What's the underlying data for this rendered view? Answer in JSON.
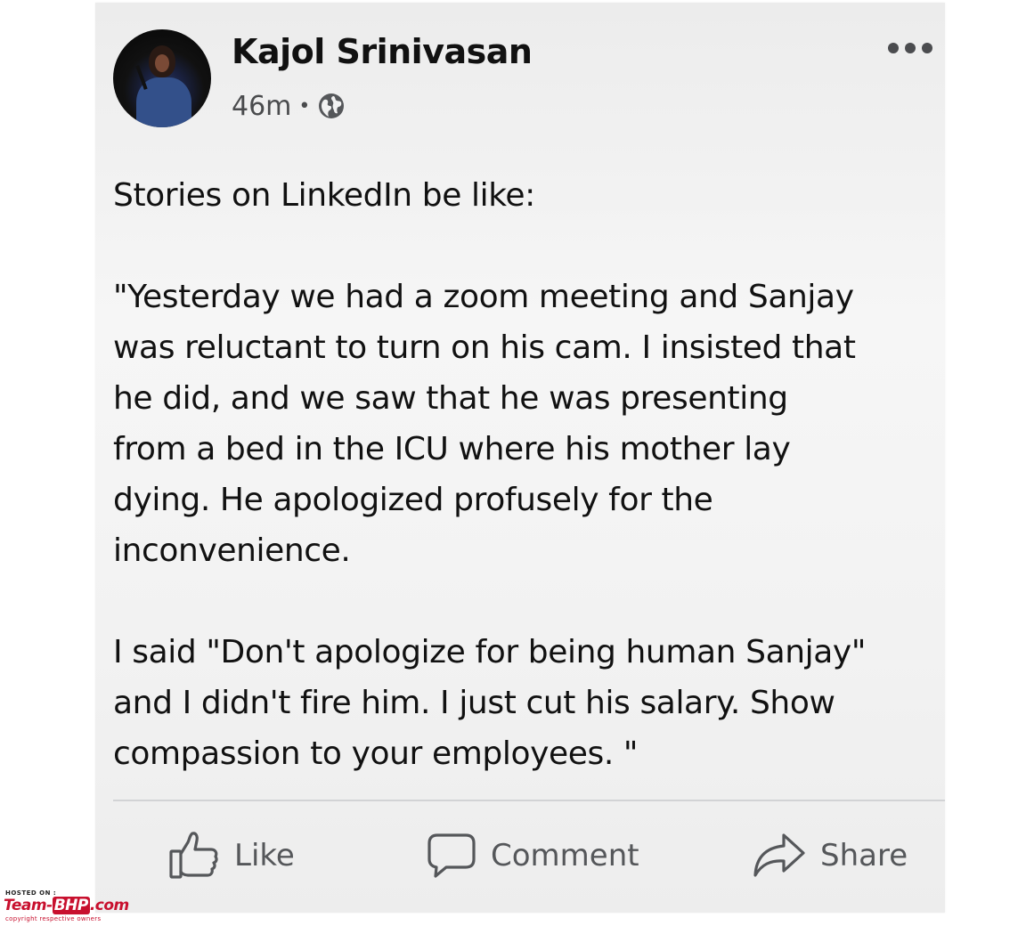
{
  "post": {
    "author": "Kajol Srinivasan",
    "timestamp": "46m",
    "separator": "•",
    "audience_icon": "globe-icon",
    "more_icon": "more-horizontal-icon",
    "paragraphs": [
      "Stories on LinkedIn be like:",
      "\"Yesterday we had a zoom meeting and Sanjay\nwas reluctant to turn on his cam. I insisted that\nhe did, and we saw that he was presenting\nfrom a bed in the ICU where his mother lay\ndying. He apologized profusely for the\ninconvenience.",
      "I said \"Don't apologize for being human Sanjay\"\nand I didn't fire him. I just cut his salary. Show\ncompassion to your employees. \""
    ]
  },
  "actions": {
    "like": {
      "label": "Like",
      "icon": "thumbs-up-icon"
    },
    "comment": {
      "label": "Comment",
      "icon": "comment-bubble-icon"
    },
    "share": {
      "label": "Share",
      "icon": "share-arrow-icon"
    }
  },
  "watermark": {
    "hosted": "HOSTED ON :",
    "brand_prefix": "Team-",
    "brand_highlight": "BHP",
    "brand_suffix": ".com",
    "copyright": "copyright respective owners"
  },
  "colors": {
    "card_background": "#f2f2f2",
    "text": "#111111",
    "secondary_text": "#4a4b4d",
    "watermark": "#c8102e"
  }
}
